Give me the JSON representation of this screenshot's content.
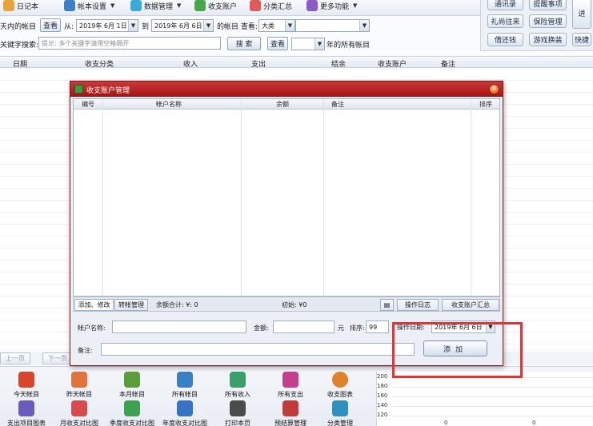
{
  "toolbar": {
    "buttons": [
      {
        "label": "日记本",
        "icon": "notebook-icon",
        "color": "#e8a33a"
      },
      {
        "label": "帐本设置",
        "icon": "ledger-icon",
        "color": "#3d7ec7"
      },
      {
        "label": "数据管理",
        "icon": "database-icon",
        "color": "#3aa8d8"
      },
      {
        "label": "收支账户",
        "icon": "wallet-icon",
        "color": "#47a84a"
      },
      {
        "label": "分类汇总",
        "icon": "category-icon",
        "color": "#e05a5a"
      },
      {
        "label": "更多功能",
        "icon": "more-icon",
        "color": "#8a5cc8"
      }
    ]
  },
  "right_panel": {
    "buttons": [
      "通讯录",
      "提醒事项",
      "礼尚往来",
      "保险管理",
      "借还钱",
      "游戏换装",
      "进",
      "快捷"
    ]
  },
  "filter": {
    "range_label": "天内的帐目",
    "view_button": "查看",
    "from_label": "从:",
    "from_date": "2019年 6月 1日",
    "to_label": "到",
    "to_date": "2019年 6月 6日",
    "account_label": "的帐目 查看:",
    "account_type": "大类",
    "account_detail": "",
    "keyword_label": "关键字搜索:",
    "keyword_placeholder": "提示: 多个关键字请用空格隔开",
    "search_button": "搜 索",
    "view_button2": "查看",
    "year_value": "",
    "year_suffix": "年的所有帐目"
  },
  "grid": {
    "columns": [
      "日期",
      "收支分类",
      "收入",
      "支出",
      "结余",
      "收支账户",
      "备注"
    ]
  },
  "pager": {
    "prev": "上一页",
    "next": "下一页"
  },
  "bottom_icons": [
    {
      "label": "今天帐目",
      "color": "#d9452b"
    },
    {
      "label": "昨天帐目",
      "color": "#e2733a"
    },
    {
      "label": "本月帐目",
      "color": "#5a9e3a"
    },
    {
      "label": "所有帐目",
      "color": "#3b7fc4"
    },
    {
      "label": "所有收入",
      "color": "#3aa06a"
    },
    {
      "label": "所有支出",
      "color": "#c53f8a"
    },
    {
      "label": "收支图表",
      "color": "#e0822b"
    },
    {
      "label": "支出项目图表",
      "color": "#6b5bbf"
    },
    {
      "label": "月收支对比图",
      "color": "#d64b4b"
    },
    {
      "label": "季度收支对比图",
      "color": "#3ea14f"
    },
    {
      "label": "年度收支对比图",
      "color": "#3574c4"
    },
    {
      "label": "打印本页",
      "color": "#4b4b4b"
    },
    {
      "label": "预结算管理",
      "color": "#c13b3b"
    },
    {
      "label": "分类管理",
      "color": "#2f8fbf"
    }
  ],
  "mini_chart": {
    "ticks": [
      "200",
      "180",
      "160",
      "140",
      "120"
    ],
    "bottom_labels": [
      "0",
      "0"
    ]
  },
  "dialog": {
    "title": "收支账户管理",
    "close_symbol": "×",
    "columns": [
      "编号",
      "帐户名称",
      "余额",
      "备注",
      "排序"
    ],
    "tabs": [
      "添加、修改",
      "转帐管理"
    ],
    "balance_total": "余额合计: ¥: 0",
    "initial": "初始: ¥0",
    "log_button": "操作日志",
    "summary_button": "收支账户汇总",
    "form": {
      "name_label": "帐户名称:",
      "name_value": "",
      "amount_label": "金额:",
      "amount_value": "",
      "unit": "元",
      "order_label": "排序:",
      "order_value": "99",
      "date_label": "操作日期:",
      "date_value": "2019年 6月 6日",
      "remark_label": "备注:",
      "remark_value": "",
      "add_button": "添加"
    }
  },
  "highlight_color": "#e23434"
}
